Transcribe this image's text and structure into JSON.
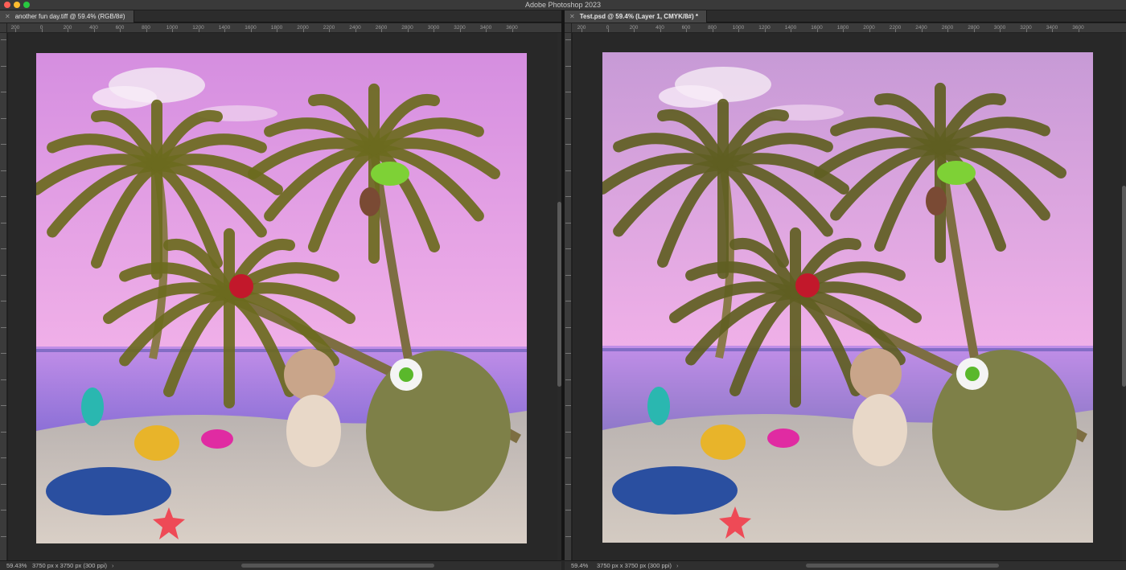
{
  "app": {
    "title": "Adobe Photoshop 2023"
  },
  "documents": [
    {
      "tab_title": "another fun day.tiff @ 59.4% (RGB/8#)",
      "zoom": "59.43%",
      "doc_info": "3750 px x 3750 px (300 ppi)",
      "ruler_labels": [
        "200",
        "0",
        "200",
        "400",
        "600",
        "800",
        "1000",
        "1200",
        "1400",
        "1600",
        "1800",
        "2000",
        "2200",
        "2400",
        "2600",
        "2800",
        "3000",
        "3200",
        "3400",
        "3600"
      ]
    },
    {
      "tab_title": "Test.psd @ 59.4% (Layer 1, CMYK/8#) *",
      "zoom": "59.4%",
      "doc_info": "3750 px x 3750 px (300 ppi)",
      "ruler_labels": [
        "200",
        "0",
        "200",
        "400",
        "600",
        "800",
        "1000",
        "1200",
        "1400",
        "1600",
        "1800",
        "2000",
        "2200",
        "2400",
        "2600",
        "2800",
        "3000",
        "3200",
        "3400",
        "3600"
      ]
    }
  ],
  "colors": {
    "sky_top": "#d58ee0",
    "sky_bottom": "#f0b0e8",
    "sea": "#8a6fd6",
    "sand": "#d9cfc6",
    "palm": "#6b6a1e",
    "cmyk_sky_top": "#c79ad6",
    "cmyk_sea": "#8d78c8",
    "cmyk_sand": "#d4cbc2",
    "cmyk_palm": "#5f5e22"
  }
}
